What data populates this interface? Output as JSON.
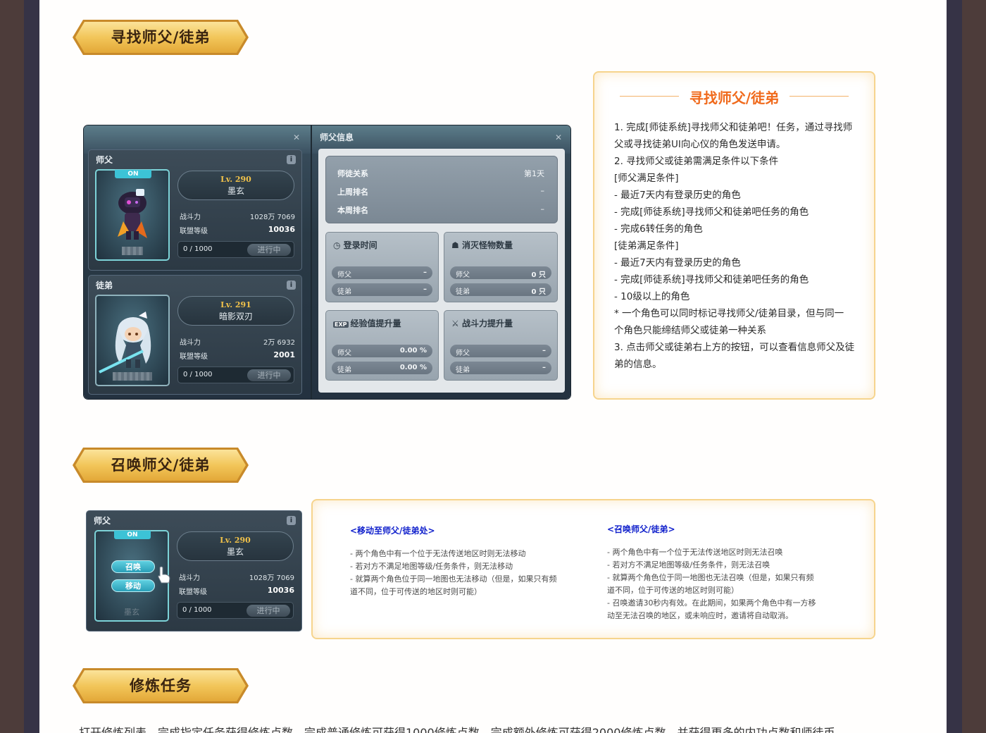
{
  "sections": {
    "find": {
      "title": "寻找师父/徒弟"
    },
    "summon": {
      "title": "召唤师父/徒弟"
    },
    "train": {
      "title": "修炼任务"
    }
  },
  "find_panel": {
    "master": {
      "label": "师父",
      "badge": "ON",
      "level": "Lv. 290",
      "name": "墨玄",
      "power_label": "战斗力",
      "power_value": "1028万 7069",
      "union_label": "联盟等级",
      "union_value": "10036",
      "progress": "0 / 1000",
      "status_button": "进行中"
    },
    "disciple": {
      "label": "徒弟",
      "level": "Lv. 291",
      "name": "暗影双刃",
      "power_label": "战斗力",
      "power_value": "2万 6932",
      "union_label": "联盟等级",
      "union_value": "2001",
      "progress": "0 / 1000",
      "status_button": "进行中"
    },
    "info": {
      "title": "师父信息",
      "relation_label": "师徒关系",
      "relation_value": "第1天",
      "last_week_label": "上周排名",
      "last_week_value": "–",
      "this_week_label": "本周排名",
      "this_week_value": "–",
      "login": {
        "title": "登录时间",
        "master": "师父",
        "master_val": "–",
        "disciple": "徒弟",
        "disciple_val": "–"
      },
      "monster": {
        "title": "消灭怪物数量",
        "master": "师父",
        "master_val": "0 只",
        "disciple": "徒弟",
        "disciple_val": "0 只"
      },
      "exp": {
        "badge": "EXP",
        "title": "经验值提升量",
        "master": "师父",
        "master_val": "0.00 %",
        "disciple": "徒弟",
        "disciple_val": "0.00 %"
      },
      "power": {
        "title": "战斗力提升量",
        "master": "师父",
        "master_val": "–",
        "disciple": "徒弟",
        "disciple_val": "–"
      }
    }
  },
  "find_card": {
    "title": "寻找师父/徒弟",
    "lines": [
      "1.   完成[师徒系统]寻找师父和徒弟吧！任务，通过寻找师",
      "父或寻找徒弟UI向心仪的角色发送申请。",
      "2.   寻找师父或徒弟需满足条件以下条件",
      "       [师父满足条件]",
      "       - 最近7天内有登录历史的角色",
      "       - 完成[师徒系统]寻找师父和徒弟吧任务的角色",
      "       - 完成6转任务的角色",
      "       [徒弟满足条件]",
      "       - 最近7天内有登录历史的角色",
      "       - 完成[师徒系统]寻找师父和徒弟吧任务的角色",
      "       - 10级以上的角色",
      " *  一个角色可以同时标记寻找师父/徒弟目录，但与同一",
      "个角色只能缔结师父或徒弟一种关系",
      "3.  点击师父或徒弟右上方的按钮，可以查看信息师父及徒",
      "弟的信息。"
    ]
  },
  "summon_panel": {
    "label": "师父",
    "badge": "ON",
    "level": "Lv. 290",
    "name": "墨玄",
    "summon_button": "召唤",
    "move_button": "移动",
    "char_name": "墨玄",
    "power_label": "战斗力",
    "power_value": "1028万 7069",
    "union_label": "联盟等级",
    "union_value": "10036",
    "progress": "0 / 1000",
    "status_button": "进行中"
  },
  "summon_card": {
    "move": {
      "heading": "<移动至师父/徒弟处>",
      "lines": [
        "- 两个角色中有一个位于无法传送地区时则无法移动",
        "- 若对方不满足地图等级/任务条件，则无法移动",
        "- 就算两个角色位于同一地图也无法移动（但是，如果只有频",
        "道不同，位于可传送的地区时则可能）"
      ]
    },
    "summon": {
      "heading": "<召唤师父/徒弟>",
      "lines": [
        "- 两个角色中有一个位于无法传送地区时则无法召唤",
        "- 若对方不满足地图等级/任务条件，则无法召唤",
        "- 就算两个角色位于同一地图也无法召唤（但是，如果只有频",
        "道不同，位于可传送的地区时则可能）",
        "- 召唤邀请30秒内有效。在此期间，如果两个角色中有一方移",
        "动至无法召唤的地区，或未响应时，邀请将自动取消。"
      ]
    }
  },
  "train_text": "打开修炼列表，完成指定任务获得修炼点数，完成普通修炼可获得1000修炼点数，完成额外修炼可获得2000修炼点数，并获得更多的内功点数和师徒币。"
}
